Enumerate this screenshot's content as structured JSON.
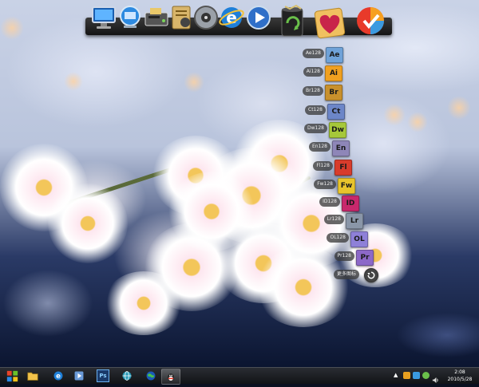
{
  "desktop": {
    "wallpaper": "cherry blossoms",
    "accent": "#f3c65a"
  },
  "dock": {
    "items": [
      {
        "name": "computer-icon"
      },
      {
        "name": "network-icon"
      },
      {
        "name": "disk-drive-icon"
      },
      {
        "name": "document-icon"
      },
      {
        "name": "media-player-icon"
      },
      {
        "name": "internet-explorer-icon"
      },
      {
        "name": "play-icon"
      },
      {
        "name": "recycle-bin-icon"
      },
      {
        "name": "favorites-heart-icon"
      },
      {
        "name": "check-icon"
      }
    ]
  },
  "stack": {
    "items": [
      {
        "label": "Ae128",
        "abbr": "Ae",
        "color": "#6fa2d8"
      },
      {
        "label": "Ai128",
        "abbr": "Ai",
        "color": "#f0a020"
      },
      {
        "label": "Br128",
        "abbr": "Br",
        "color": "#c8902c"
      },
      {
        "label": "Ct128",
        "abbr": "Ct",
        "color": "#6c86c8"
      },
      {
        "label": "Dw128",
        "abbr": "Dw",
        "color": "#a6c83a"
      },
      {
        "label": "En128",
        "abbr": "En",
        "color": "#8e86b8"
      },
      {
        "label": "Fl128",
        "abbr": "Fl",
        "color": "#d83c2c"
      },
      {
        "label": "Fw128",
        "abbr": "Fw",
        "color": "#e8c42c"
      },
      {
        "label": "ID128",
        "abbr": "ID",
        "color": "#c8286c"
      },
      {
        "label": "Lr128",
        "abbr": "Lr",
        "color": "#8a96a8"
      },
      {
        "label": "OL128",
        "abbr": "OL",
        "color": "#8e80d8"
      },
      {
        "label": "Pr128",
        "abbr": "Pr",
        "color": "#8c68c8"
      },
      {
        "label": "更多图标",
        "abbr": ""
      }
    ]
  },
  "taskbar": {
    "pinned": [
      {
        "name": "folder-icon"
      },
      {
        "name": "internet-explorer-icon"
      },
      {
        "name": "windows-media-icon"
      },
      {
        "name": "photoshop-icon",
        "text": "Ps"
      },
      {
        "name": "network-globe-icon"
      },
      {
        "name": "earth-icon"
      },
      {
        "name": "qq-icon"
      }
    ],
    "clock": {
      "time": "2:08",
      "date": "2010/5/28"
    }
  }
}
